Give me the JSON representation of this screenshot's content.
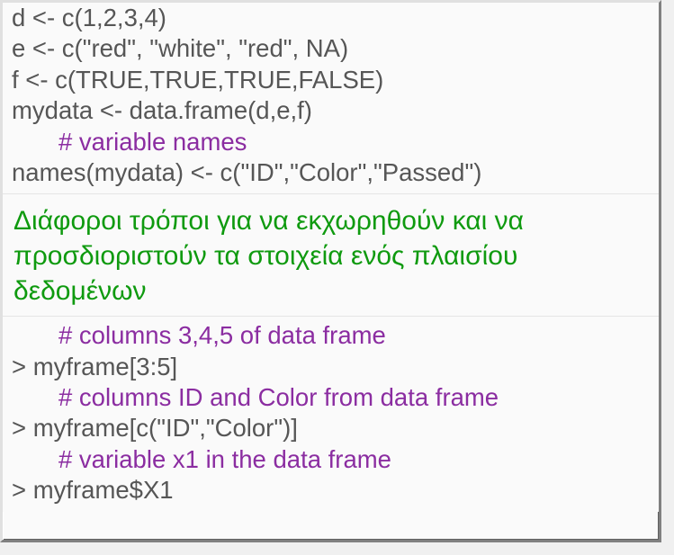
{
  "block1": {
    "line1": "d <- c(1,2,3,4)",
    "line2": "e <- c(\"red\", \"white\", \"red\", NA)",
    "line3": "f <- c(TRUE,TRUE,TRUE,FALSE)",
    "line4": "mydata <- data.frame(d,e,f)",
    "comment1": "# variable names",
    "line5": "names(mydata) <- c(\"ID\",\"Color\",\"Passed\")"
  },
  "heading": "Διάφοροι τρόποι για να εκχωρηθούν και να προσδιοριστούν τα στοιχεία ενός πλαισίου δεδομένων",
  "block2": {
    "comment1": "# columns 3,4,5 of data frame",
    "line1": "> myframe[3:5]",
    "comment2": "# columns ID and Color from data frame",
    "line2": "> myframe[c(\"ID\",\"Color\")]",
    "comment3": "# variable x1 in the data frame",
    "line3": "> myframe$X1"
  }
}
